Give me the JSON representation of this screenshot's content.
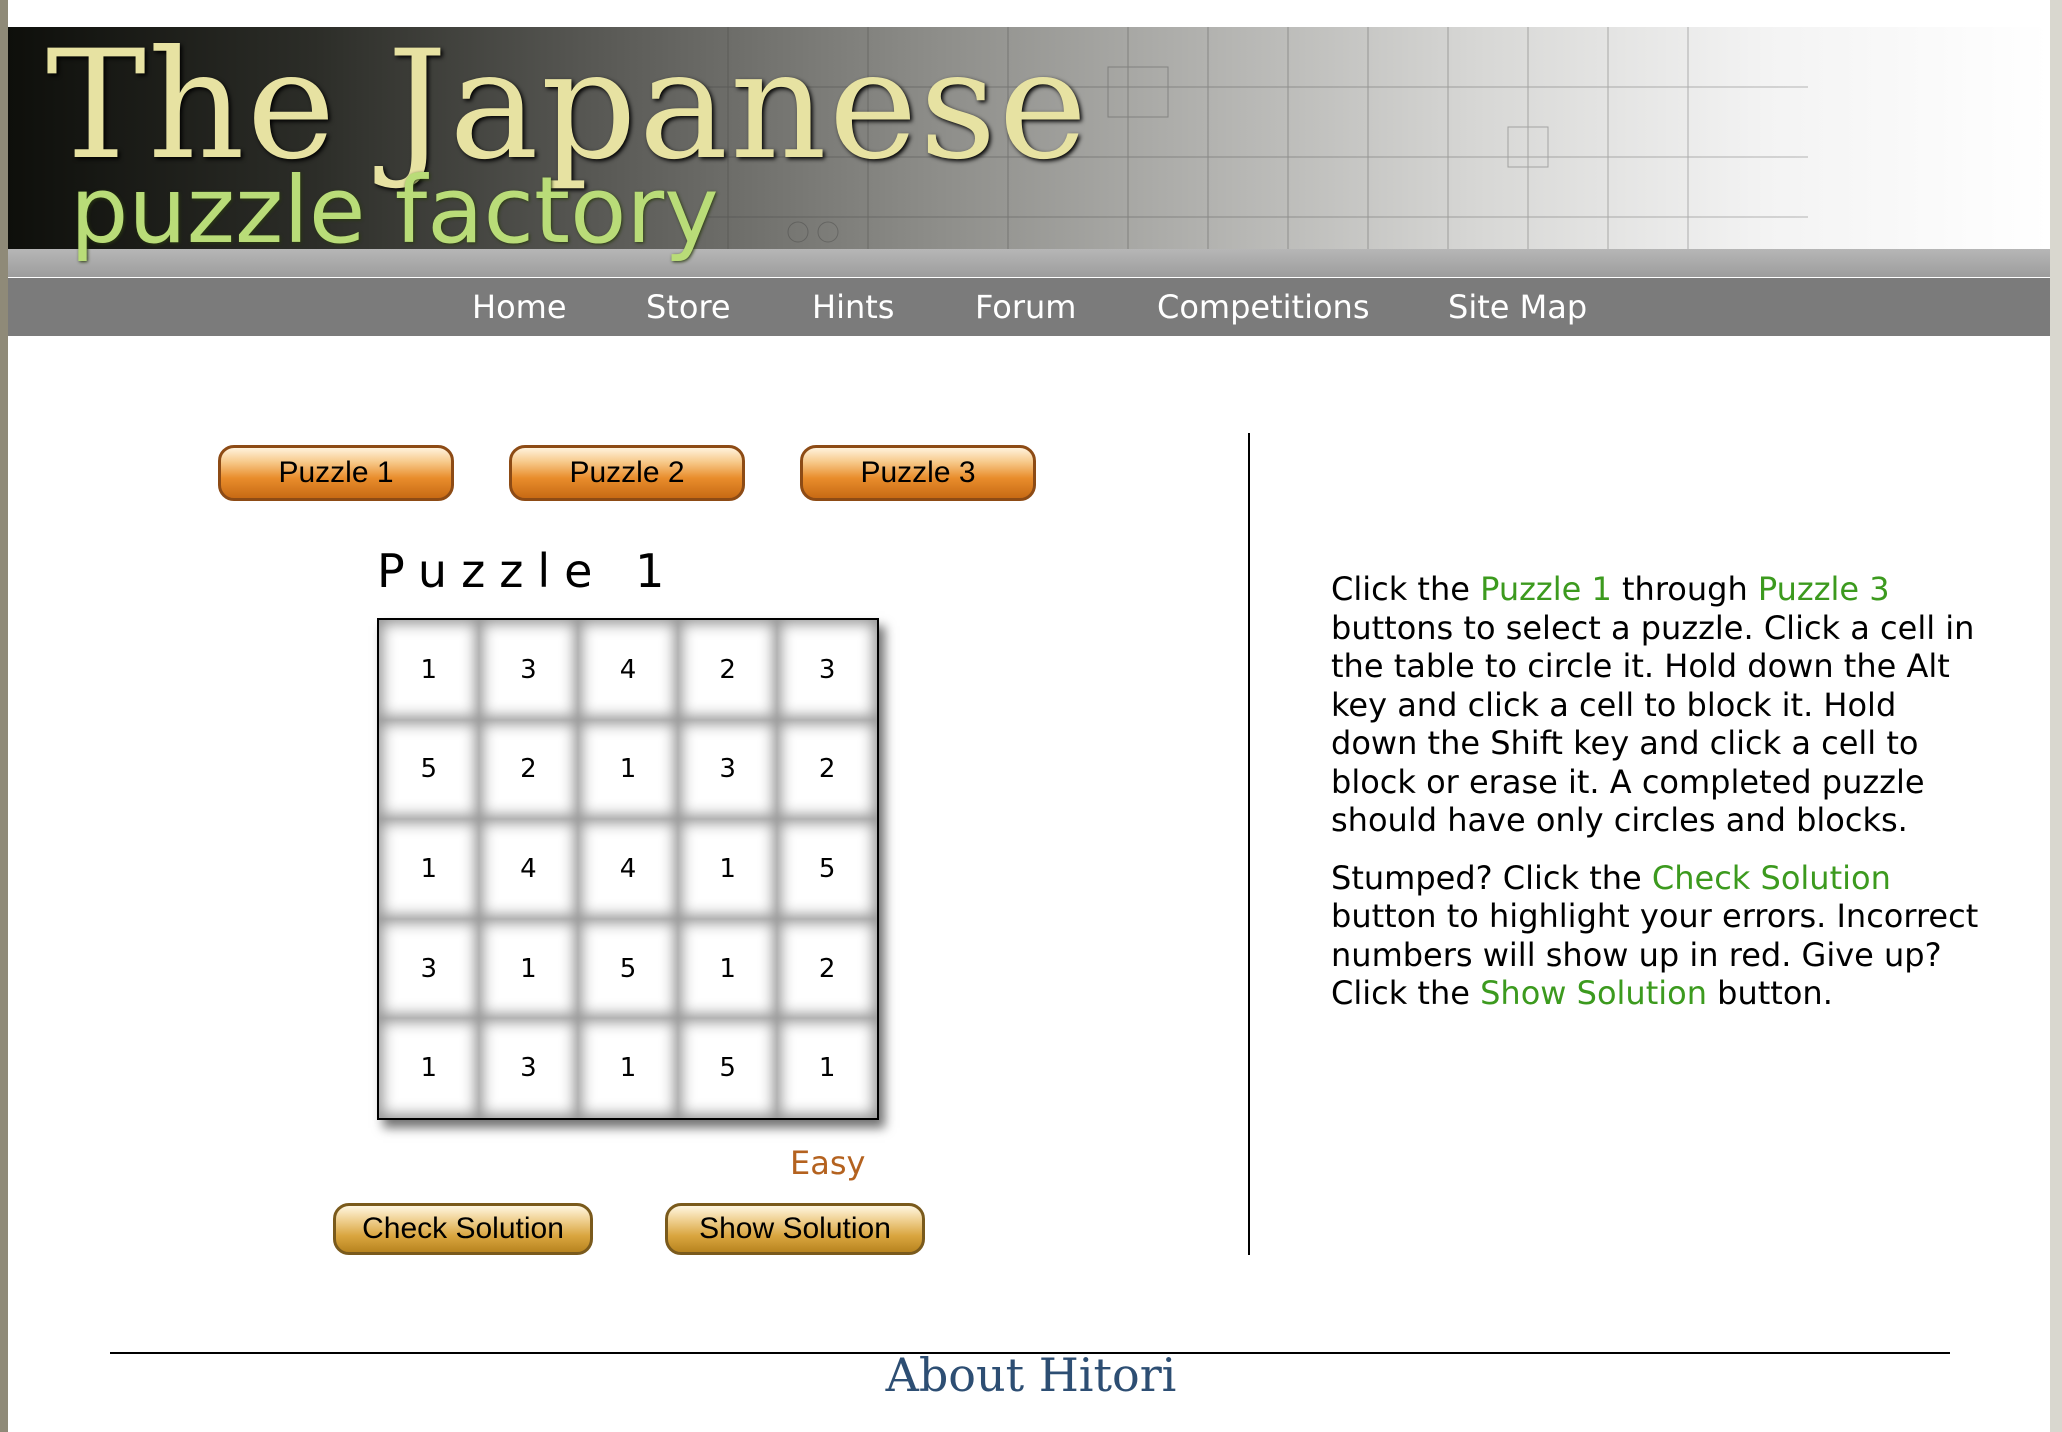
{
  "header": {
    "logo_line1": "The Japanese",
    "logo_line2": "puzzle factory"
  },
  "nav": {
    "items": [
      {
        "label": "Home"
      },
      {
        "label": "Store"
      },
      {
        "label": "Hints"
      },
      {
        "label": "Forum"
      },
      {
        "label": "Competitions"
      },
      {
        "label": "Site Map"
      }
    ]
  },
  "puzzle_buttons": [
    {
      "label": "Puzzle 1"
    },
    {
      "label": "Puzzle 2"
    },
    {
      "label": "Puzzle 3"
    }
  ],
  "puzzle": {
    "title": "Puzzle 1",
    "grid": [
      [
        "1",
        "3",
        "4",
        "2",
        "3"
      ],
      [
        "5",
        "2",
        "1",
        "3",
        "2"
      ],
      [
        "1",
        "4",
        "4",
        "1",
        "5"
      ],
      [
        "3",
        "1",
        "5",
        "1",
        "2"
      ],
      [
        "1",
        "3",
        "1",
        "5",
        "1"
      ]
    ],
    "difficulty": "Easy"
  },
  "actions": {
    "check_label": "Check Solution",
    "show_label": "Show Solution"
  },
  "instructions": {
    "p1": [
      {
        "text": "Click the ",
        "hl": false
      },
      {
        "text": "Puzzle 1",
        "hl": true
      },
      {
        "text": " through ",
        "hl": false
      },
      {
        "text": "Puzzle 3",
        "hl": true
      },
      {
        "text": " buttons to select a puzzle. Click a cell in the table to circle it. Hold down the Alt key and click a cell to block it. Hold down the Shift key and click a cell to block or erase it. A completed puzzle should have only circles and blocks.",
        "hl": false
      }
    ],
    "p2": [
      {
        "text": "Stumped? Click the ",
        "hl": false
      },
      {
        "text": "Check Solution",
        "hl": true
      },
      {
        "text": " button to highlight your errors. Incorrect numbers will show up in red. Give up? Click the ",
        "hl": false
      },
      {
        "text": "Show Solution",
        "hl": true
      },
      {
        "text": " button.",
        "hl": false
      }
    ]
  },
  "footer": {
    "about_title": "About Hitori"
  },
  "colors": {
    "highlight": "#3c9a1e",
    "difficulty": "#b4621f",
    "nav_bg": "#7b7b7b",
    "about": "#2d4e73"
  }
}
